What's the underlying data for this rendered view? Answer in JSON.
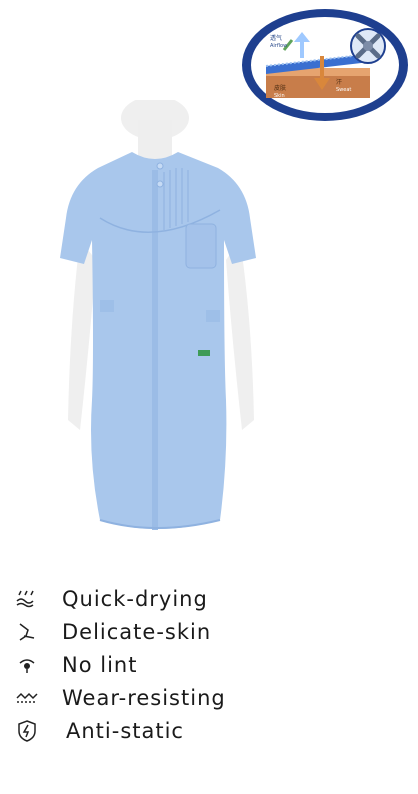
{
  "badge": {
    "icons": [
      "fabric-layer-diagram-icon",
      "bacteria-cross-icon"
    ],
    "texts": {
      "top_left": "透气",
      "top_left_sub": "Airflow",
      "skin_cn": "皮肤",
      "skin_en": "Skin",
      "sweat_cn": "汗",
      "sweat_en": "Sweat"
    },
    "colors": {
      "ring": "#1e3f8f",
      "inner": "#ffffff",
      "fabric": "#3a6fd0",
      "skin": "#c87d4a"
    }
  },
  "product": {
    "image": "light-blue-short-sleeve-dress-on-mannequin",
    "colors": {
      "dress": "#a9c7ec",
      "dress_shadow": "#8fb2e0",
      "mannequin": "#efefef"
    }
  },
  "features": [
    {
      "icon": "quick-drying-icon",
      "label": "Quick-drying"
    },
    {
      "icon": "delicate-skin-icon",
      "label": "Delicate-skin"
    },
    {
      "icon": "no-lint-icon",
      "label": "No lint"
    },
    {
      "icon": "wear-resisting-icon",
      "label": "Wear-resisting"
    },
    {
      "icon": "anti-static-icon",
      "label": "Anti-static"
    }
  ]
}
